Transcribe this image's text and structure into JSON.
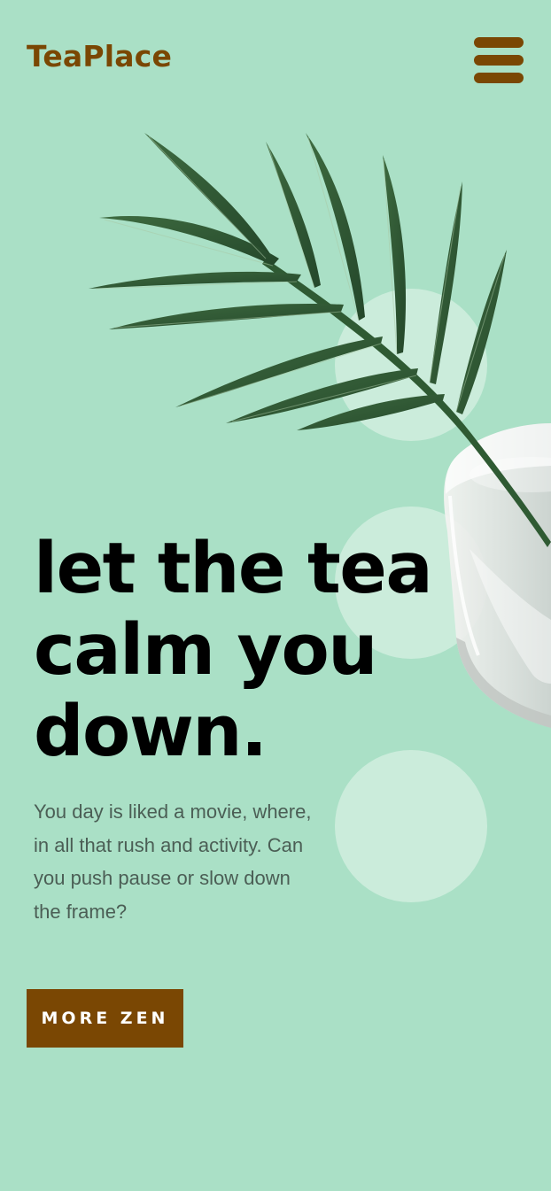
{
  "header": {
    "logo_text": "TeaPlace"
  },
  "hero": {
    "headline_lines": [
      "let the tea",
      "calm you",
      "down."
    ],
    "description_lines": [
      "You day is liked a movie, where,",
      "in all that rush and activity. Can",
      "you push pause or slow down",
      "the frame?"
    ],
    "cta_label": "MORE ZEN"
  },
  "icons": {
    "menu": "hamburger-menu-icon",
    "leaf": "palm-leaf-image",
    "glass": "tea-glass-image"
  },
  "colors": {
    "background": "#aae0c6",
    "accent_brown": "#7a4703",
    "circle": "#cbecdb",
    "headline": "#000000",
    "body_text": "#4b5e55",
    "leaf_green": "#2f5a33"
  }
}
